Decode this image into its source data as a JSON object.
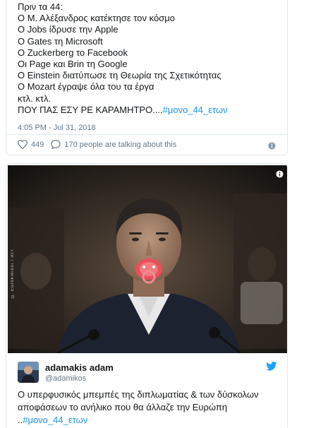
{
  "tweet1": {
    "lines": [
      "Πριν τα 44:",
      "Ο Μ. Αλέξανδρος κατέκτησε τον κόσμο",
      "Ο Jobs ίδρυσε την Apple",
      "Ο Gates τη Microsoft",
      "Ο Zuckerberg το Facebook",
      "Οι Page και Brin τη Google",
      "Ο Einstein διατύπωσε τη Θεωρία της Σχετικότητας",
      "Ο Mozart έγραψε όλα του τα έργα",
      "κτλ. κτλ."
    ],
    "last_text": "ΠΟΥ ΠΑΣ ΕΣΥ ΡΕ ΚΑΡΑΜΗΤΡΟ....",
    "last_hashtag": "#μονο_44_ετων",
    "timestamp": "4:05 PM - Jul 31, 2018",
    "likes": "449",
    "talking": "170 people are talking about this"
  },
  "tweet2": {
    "author_name": "adamakis adam",
    "author_handle": "@adamikos",
    "photo_credit": "© Eurokinissi / AIT",
    "text_line1": "Ο υπερφυσικός μπεμπές της διπλωματίας & των δύσκολων",
    "text_line2": "αποφάσεων  το ανήλικο που θα άλλαζε την Ευρώπη",
    "text_prefix": "..",
    "hashtag": "#μονο_44_ετων"
  },
  "colors": {
    "accent": "#1b95e0",
    "muted": "#657786",
    "border": "#e1e8ed",
    "pacifier": "#e8505b"
  },
  "icons": [
    "heart-icon",
    "speech-bubble-icon",
    "info-icon",
    "twitter-bird-icon"
  ]
}
